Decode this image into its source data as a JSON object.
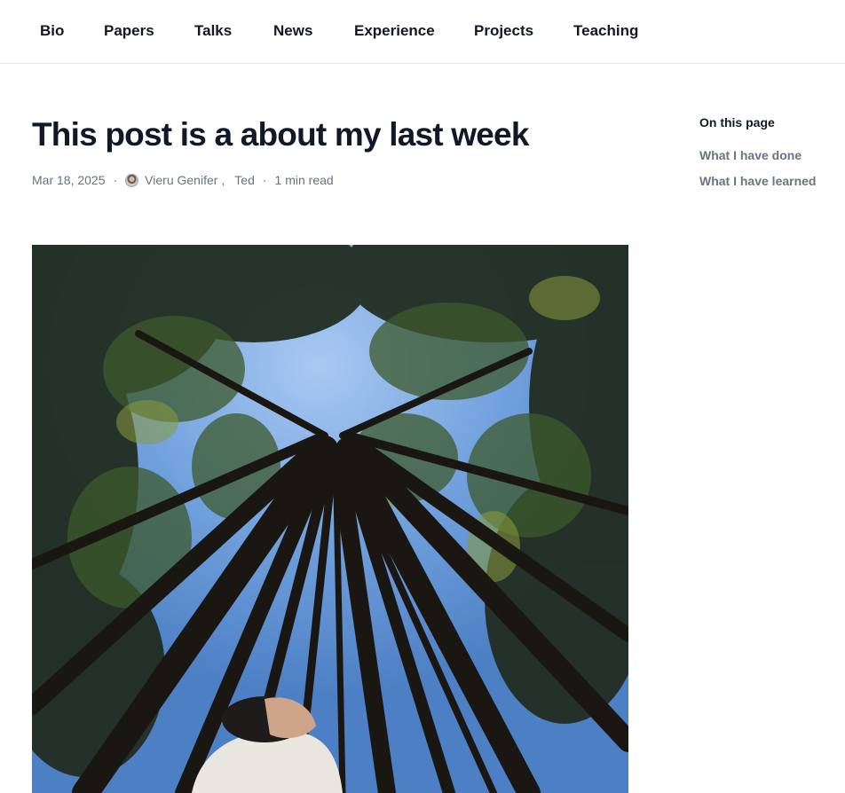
{
  "nav": {
    "items": [
      {
        "label": "Bio"
      },
      {
        "label": "Papers"
      },
      {
        "label": "Talks"
      },
      {
        "label": "News"
      },
      {
        "label": "Experience"
      },
      {
        "label": "Projects"
      },
      {
        "label": "Teaching"
      }
    ]
  },
  "post": {
    "title": "This post is a about my last week",
    "date": "Mar 18, 2025",
    "separator": "·",
    "authors": [
      "Vieru Genifer",
      "Ted"
    ],
    "author_separator": ",",
    "read_time": "1 min read",
    "image_icon": "photo-forest-canopy"
  },
  "toc": {
    "heading": "On this page",
    "items": [
      {
        "label": "What I have done"
      },
      {
        "label": "What I have learned"
      }
    ]
  },
  "colors": {
    "text_primary": "#111827",
    "text_muted": "#6b7280",
    "sky": "#6fa2e0"
  }
}
